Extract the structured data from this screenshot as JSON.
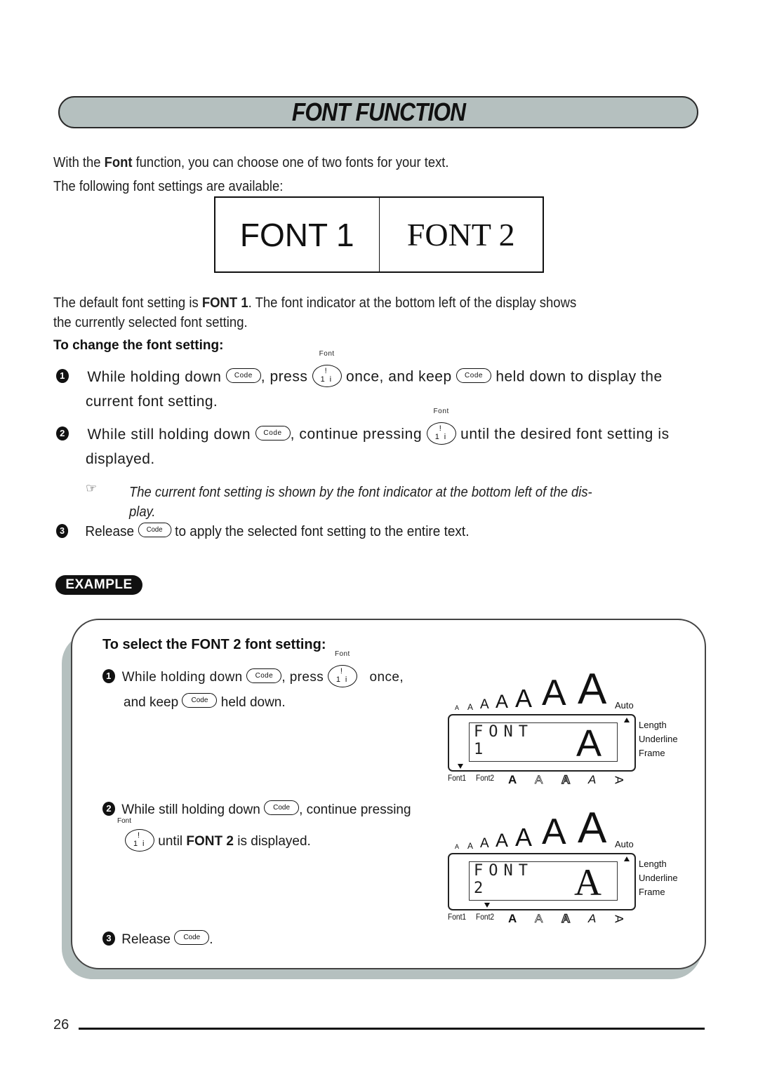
{
  "title": "FONT FUNCTION",
  "intro": {
    "line1_before": "With the ",
    "line1_bold": "Font",
    "line1_after": " function, you can choose one of two fonts for your text.",
    "line2": "The following font settings are available:"
  },
  "font_samples": [
    "FONT 1",
    "FONT 2"
  ],
  "default_para": {
    "before": "The default font setting is ",
    "bold": "FONT 1",
    "after": ". The font indicator at the bottom left of the display shows",
    "line2": "the currently selected font setting."
  },
  "change_heading": "To change the font setting:",
  "keys": {
    "code": "Code",
    "font_caption": "Font",
    "font_top": "!",
    "font_bottom_left": "1",
    "font_bottom_right": "i"
  },
  "steps": [
    {
      "num": "1",
      "part1": "While holding down",
      "part2": ", press",
      "part3": "once, and keep",
      "part4": "held down to display the",
      "line2": "current font setting."
    },
    {
      "num": "2",
      "part1": "While still holding down",
      "part2": ", continue pressing",
      "part3": "until the desired font setting is",
      "line2": "displayed."
    },
    {
      "num": "3",
      "part1": "Release",
      "part2": "to apply the selected font setting to the entire text."
    }
  ],
  "note": {
    "icon": "pointing-hand-icon",
    "line1": "The current font setting is shown by the font indicator at the bottom left of the dis-",
    "line2": "play."
  },
  "example": {
    "badge": "EXAMPLE",
    "heading": "To select the FONT 2 font setting:",
    "step1": {
      "num": "1",
      "part1": "While holding down",
      "part2": ", press",
      "part3": "once,",
      "line2a": "and keep",
      "line2b": "held down."
    },
    "step2": {
      "num": "2",
      "part1": "While still holding down",
      "part2": ", continue pressing",
      "line2a": "until ",
      "line2bold": "FONT 2",
      "line2b": " is displayed."
    },
    "step3": {
      "num": "3",
      "part1": "Release",
      "part2": "."
    }
  },
  "lcd": {
    "size_glyphs": [
      "A",
      "A",
      "A",
      "A",
      "A",
      "A",
      "A"
    ],
    "auto_label": "Auto",
    "side_labels": [
      "Length",
      "Underline",
      "Frame"
    ],
    "bottom_labels": [
      "Font1",
      "Font2",
      "A",
      "A",
      "A",
      "A",
      "A"
    ],
    "screens": [
      {
        "line1": "FONT",
        "line2": "1",
        "big": "A",
        "indicator": "Font1"
      },
      {
        "line1": "FONT",
        "line2": "2",
        "big": "A",
        "indicator": "Font2"
      }
    ]
  },
  "page_number": "26"
}
